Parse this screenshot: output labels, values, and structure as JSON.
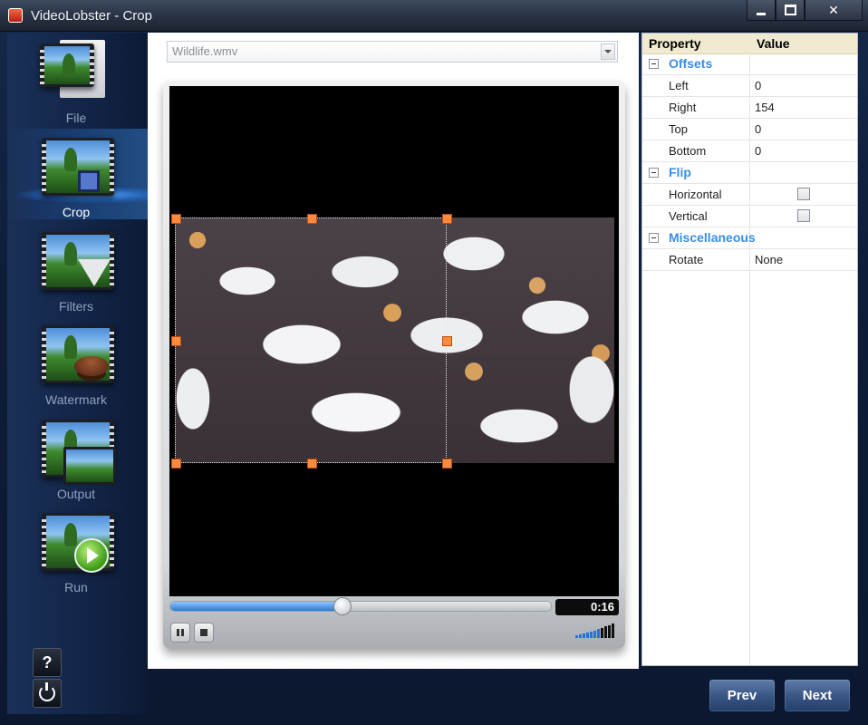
{
  "window": {
    "title": "VideoLobster - Crop"
  },
  "sidebar": {
    "items": [
      {
        "label": "File",
        "icon": "file-video-icon"
      },
      {
        "label": "Crop",
        "icon": "crop-video-icon",
        "active": true
      },
      {
        "label": "Filters",
        "icon": "filter-funnel-icon"
      },
      {
        "label": "Watermark",
        "icon": "watermark-stamp-icon"
      },
      {
        "label": "Output",
        "icon": "output-video-icon"
      },
      {
        "label": "Run",
        "icon": "play-icon"
      }
    ],
    "help_label": "?"
  },
  "file_select": {
    "value": "Wildlife.wmv"
  },
  "player": {
    "time": "0:16",
    "progress_fraction": 0.45,
    "volume_level": "high"
  },
  "properties": {
    "header": {
      "property": "Property",
      "value": "Value"
    },
    "categories": [
      {
        "name": "Offsets",
        "rows": [
          {
            "name": "Left",
            "value": "0"
          },
          {
            "name": "Right",
            "value": "154"
          },
          {
            "name": "Top",
            "value": "0"
          },
          {
            "name": "Bottom",
            "value": "0"
          }
        ]
      },
      {
        "name": "Flip",
        "rows": [
          {
            "name": "Horizontal",
            "checked": false
          },
          {
            "name": "Vertical",
            "checked": false
          }
        ]
      },
      {
        "name": "Miscellaneous",
        "rows": [
          {
            "name": "Rotate",
            "value": "None"
          }
        ]
      }
    ]
  },
  "buttons": {
    "prev": "Prev",
    "next": "Next"
  },
  "colors": {
    "accent": "#3a8ee6",
    "crop_handle": "#ff8a3d",
    "category_text": "#3a8ee6"
  }
}
